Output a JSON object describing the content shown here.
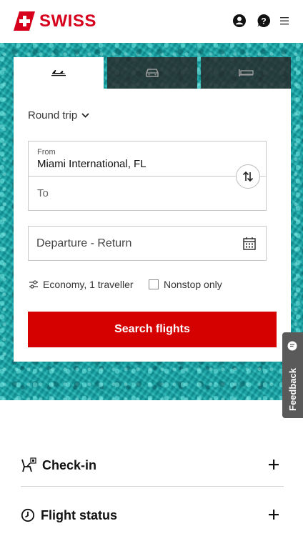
{
  "header": {
    "brand": "SWISS",
    "brand_color": "#d6001c",
    "icons": [
      "user-icon",
      "help-icon",
      "menu-icon"
    ]
  },
  "tabs": [
    {
      "name": "flights",
      "icon": "plane-icon",
      "active": true
    },
    {
      "name": "cars",
      "icon": "car-icon",
      "active": false
    },
    {
      "name": "hotels",
      "icon": "bed-icon",
      "active": false
    }
  ],
  "search": {
    "trip_type": "Round trip",
    "from_label": "From",
    "from_value": "Miami International, FL",
    "to_placeholder": "To",
    "dates_placeholder": "Departure - Return",
    "passengers": "Economy, 1 traveller",
    "nonstop_label": "Nonstop only",
    "submit_label": "Search flights",
    "button_color": "#d50000"
  },
  "feedback": {
    "label": "Feedback"
  },
  "accordion": [
    {
      "label": "Check-in",
      "icon": "seat-icon"
    },
    {
      "label": "Flight status",
      "icon": "clock-icon"
    }
  ]
}
